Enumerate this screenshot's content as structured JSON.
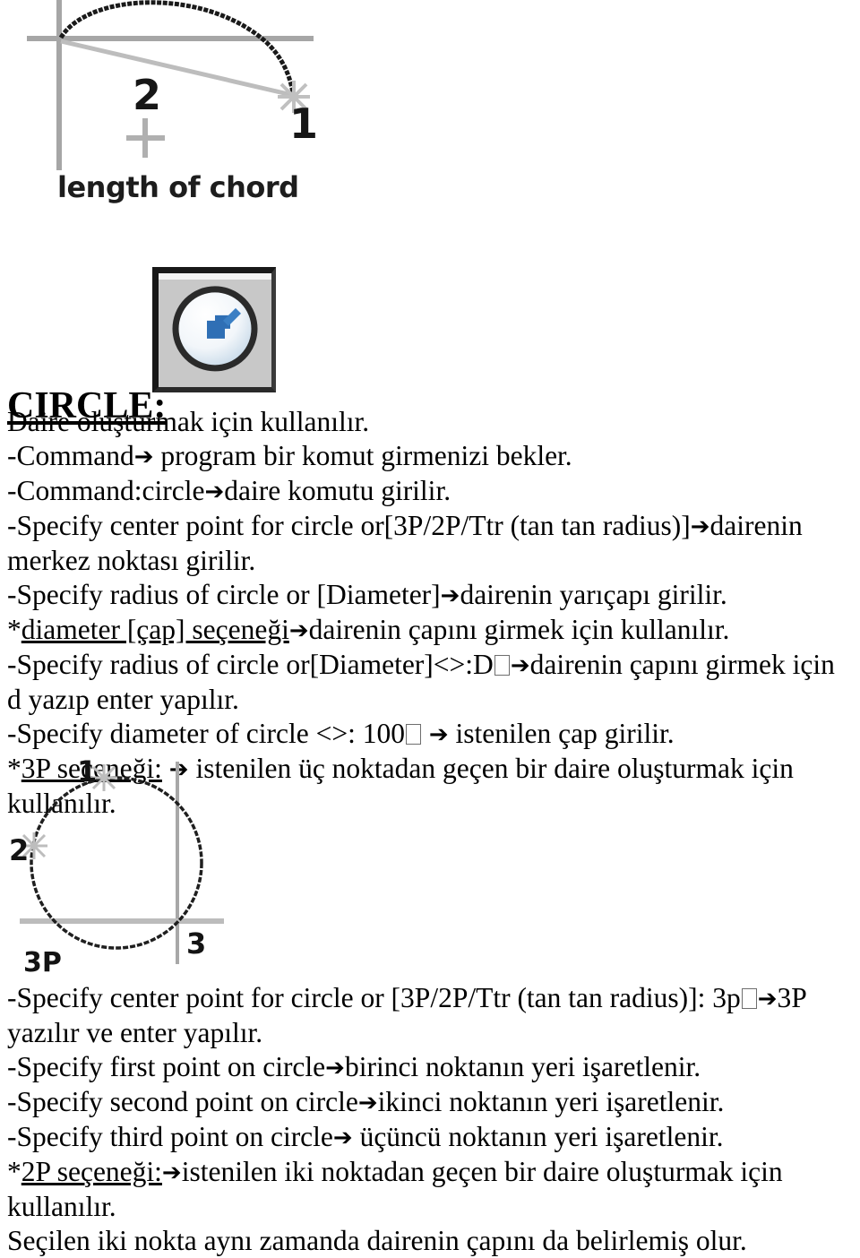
{
  "document": {
    "title_heading": "CIRCLE:",
    "language": "tr"
  },
  "chord_figure": {
    "name": "arc-length-of-chord-diagram",
    "caption": "length of chord",
    "point_labels": [
      "1",
      "2"
    ],
    "description": "AutoCAD arc preview with crosshair, chord line and two pick points"
  },
  "toolbar_icon": {
    "name": "circle-tool-icon",
    "button_fill": "#c8c8c8",
    "accent_color": "#2f6fb5",
    "label": "Circle"
  },
  "body": {
    "lines": [
      {
        "id": "l1",
        "parts": [
          {
            "t": "Daire oluşturmak için kullanılır."
          }
        ]
      },
      {
        "id": "l2",
        "parts": [
          {
            "t": "-Command"
          },
          {
            "arrow": "➔"
          },
          {
            "t": " program bir komut girmenizi bekler."
          }
        ]
      },
      {
        "id": "l3",
        "parts": [
          {
            "t": "-Command:circle"
          },
          {
            "arrow": "➔"
          },
          {
            "t": "daire komutu girilir."
          }
        ]
      },
      {
        "id": "l4",
        "parts": [
          {
            "t": "-Specify center point for circle or[3P/2P/Ttr (tan tan radius)]"
          },
          {
            "arrow": "➔"
          },
          {
            "t": "dairenin merkez noktası girilir."
          }
        ]
      },
      {
        "id": "l5",
        "parts": [
          {
            "t": "-Specify radius of circle or [Diameter]"
          },
          {
            "arrow": "➔"
          },
          {
            "t": "dairenin yarıçapı girilir."
          }
        ]
      },
      {
        "id": "l6",
        "parts": [
          {
            "t": "*",
            "style": "plain"
          },
          {
            "t": "diameter [çap] seçeneği",
            "style": "underline"
          },
          {
            "arrow": "➔"
          },
          {
            "t": "dairenin çapını girmek için kullanılır."
          }
        ]
      },
      {
        "id": "l7",
        "parts": [
          {
            "t": "-Specify radius of circle or[Diameter]<>:D"
          },
          {
            "box": true
          },
          {
            "arrow": "➔"
          },
          {
            "t": "dairenin çapını girmek için d yazıp enter yapılır."
          }
        ]
      },
      {
        "id": "l8",
        "parts": [
          {
            "t": "-Specify diameter of circle <>: 100"
          },
          {
            "box": true
          },
          {
            "t": " "
          },
          {
            "arrow": "➔"
          },
          {
            "t": " istenilen çap girilir."
          }
        ]
      },
      {
        "id": "l9",
        "parts": [
          {
            "t": "*",
            "style": "plain"
          },
          {
            "t": "3P seçeneği:",
            "style": "underline"
          },
          {
            "t": " "
          },
          {
            "arrow": "➔"
          },
          {
            "t": " istenilen üç noktadan geçen bir daire oluşturmak için kullanılır."
          }
        ]
      }
    ],
    "lines_after_figure": [
      {
        "id": "l10",
        "parts": [
          {
            "t": "-Specify center point for circle or [3P/2P/Ttr (tan tan radius)]: 3p"
          },
          {
            "box": true
          },
          {
            "arrow": "➔"
          },
          {
            "t": "3P yazılır ve enter yapılır."
          }
        ]
      },
      {
        "id": "l11",
        "parts": [
          {
            "t": "-Specify first point on circle"
          },
          {
            "arrow": "➔"
          },
          {
            "t": "birinci noktanın yeri işaretlenir."
          }
        ]
      },
      {
        "id": "l12",
        "parts": [
          {
            "t": "-Specify second point on circle"
          },
          {
            "arrow": "➔"
          },
          {
            "t": "ikinci noktanın yeri işaretlenir."
          }
        ]
      },
      {
        "id": "l13",
        "parts": [
          {
            "t": "-Specify third point on circle"
          },
          {
            "arrow": "➔"
          },
          {
            "t": " üçüncü noktanın yeri işaretlenir."
          }
        ]
      },
      {
        "id": "l14",
        "parts": [
          {
            "t": "*",
            "style": "plain"
          },
          {
            "t": "2P seçeneği:",
            "style": "underline"
          },
          {
            "arrow": "➔"
          },
          {
            "t": "istenilen iki noktadan geçen bir daire oluşturmak için kullanılır."
          }
        ]
      },
      {
        "id": "l15",
        "parts": [
          {
            "t": "Seçilen iki nokta aynı zamanda dairenin çapını da belirlemiş olur."
          }
        ]
      }
    ]
  },
  "threep_figure": {
    "name": "three-point-circle-diagram",
    "caption": "3P",
    "point_labels": [
      "1",
      "2",
      "3"
    ],
    "description": "Circle drawn through three picked points with crosshair axes"
  }
}
